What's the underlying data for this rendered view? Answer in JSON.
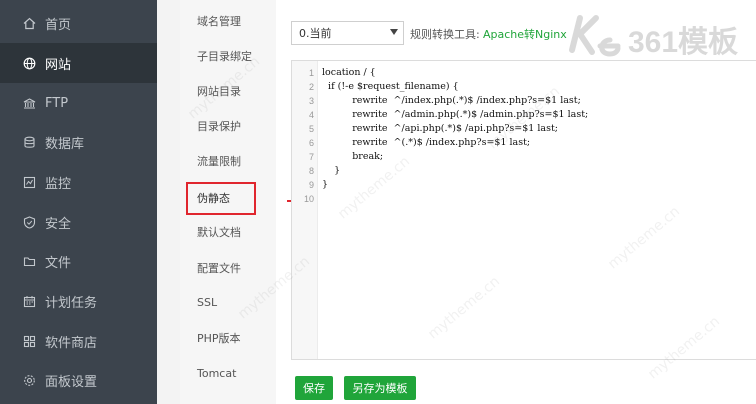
{
  "nav": {
    "items": [
      {
        "label": "首页",
        "icon": "home-icon"
      },
      {
        "label": "网站",
        "icon": "globe-icon",
        "active": true
      },
      {
        "label": "FTP",
        "icon": "ftp-icon"
      },
      {
        "label": "数据库",
        "icon": "database-icon"
      },
      {
        "label": "监控",
        "icon": "monitor-icon"
      },
      {
        "label": "安全",
        "icon": "shield-icon"
      },
      {
        "label": "文件",
        "icon": "folder-icon"
      },
      {
        "label": "计划任务",
        "icon": "calendar-icon"
      },
      {
        "label": "软件商店",
        "icon": "grid-icon"
      },
      {
        "label": "面板设置",
        "icon": "settings-icon"
      }
    ]
  },
  "menu": {
    "items": [
      {
        "label": "域名管理"
      },
      {
        "label": "子目录绑定"
      },
      {
        "label": "网站目录"
      },
      {
        "label": "目录保护"
      },
      {
        "label": "流量限制"
      },
      {
        "label": "伪静态",
        "active": true
      },
      {
        "label": "默认文档"
      },
      {
        "label": "配置文件"
      },
      {
        "label": "SSL"
      },
      {
        "label": "PHP版本"
      },
      {
        "label": "Tomcat"
      }
    ]
  },
  "rewrite": {
    "selected": "0.当前",
    "tool_label": "规则转换工具:",
    "tool_link": "Apache转Nginx"
  },
  "editor": {
    "lines": [
      "location / {",
      "  if (!-e $request_filename) {",
      "          rewrite  ^/index.php(.*)$ /index.php?s=$1 last;",
      "          rewrite  ^/admin.php(.*)$ /admin.php?s=$1 last;",
      "          rewrite  ^/api.php(.*)$ /api.php?s=$1 last;",
      "          rewrite  ^(.*)$ /index.php?s=$1 last;",
      "          break;",
      "    }",
      "}",
      ""
    ],
    "line_numbers": [
      "1",
      "2",
      "3",
      "4",
      "5",
      "6",
      "7",
      "8",
      "9",
      "10"
    ]
  },
  "buttons": {
    "save": "保存",
    "save_as_template": "另存为模板"
  },
  "watermark": {
    "logo_text": "361模板",
    "text": "mytheme.cn"
  },
  "colors": {
    "sidebar_bg": "#3c444d",
    "sidebar_active": "#2d343a",
    "accent_green": "#20a53a",
    "highlight_red": "#e0262e"
  }
}
